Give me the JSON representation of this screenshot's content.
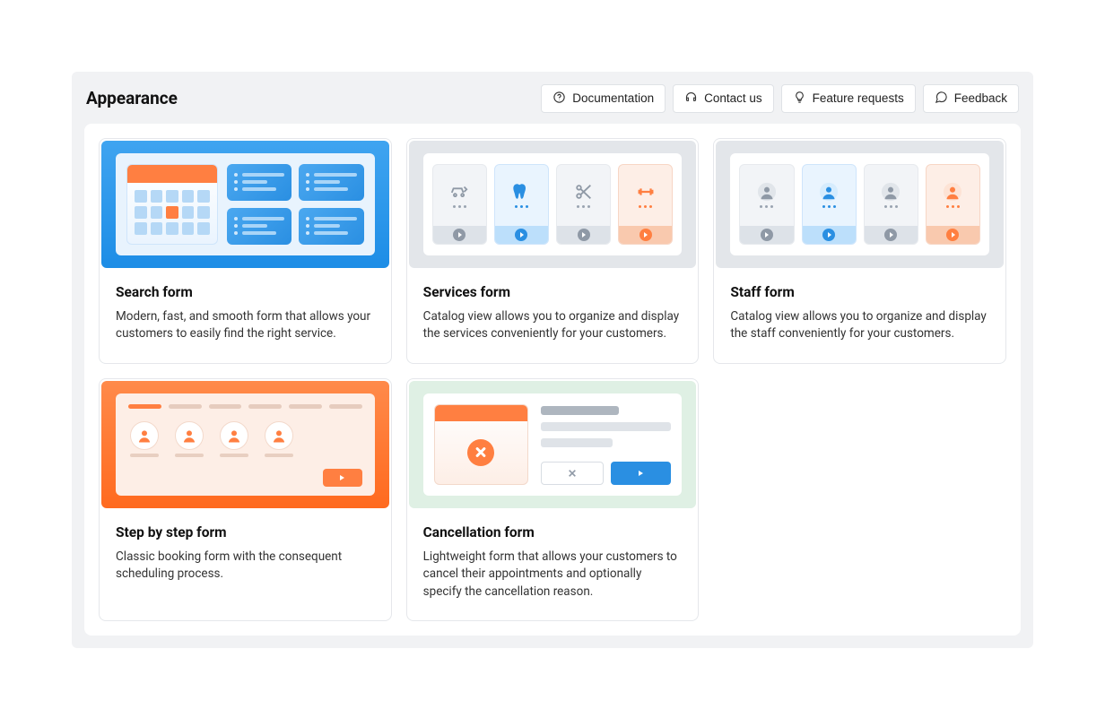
{
  "page": {
    "title": "Appearance"
  },
  "header": {
    "documentation": "Documentation",
    "contact": "Contact us",
    "feature": "Feature requests",
    "feedback": "Feedback"
  },
  "cards": {
    "search": {
      "title": "Search form",
      "desc": "Modern, fast, and smooth form that allows your customers to easily find the right service."
    },
    "services": {
      "title": "Services form",
      "desc": "Catalog view allows you to organize and display the services conveniently for your customers."
    },
    "staff": {
      "title": "Staff form",
      "desc": "Catalog view allows you to organize and display the staff conveniently for your customers."
    },
    "step": {
      "title": "Step by step form",
      "desc": "Classic booking form with the consequent scheduling process."
    },
    "cancel": {
      "title": "Cancellation form",
      "desc": "Lightweight form that allows your customers to cancel their appointments and optionally specify the cancellation reason."
    }
  }
}
